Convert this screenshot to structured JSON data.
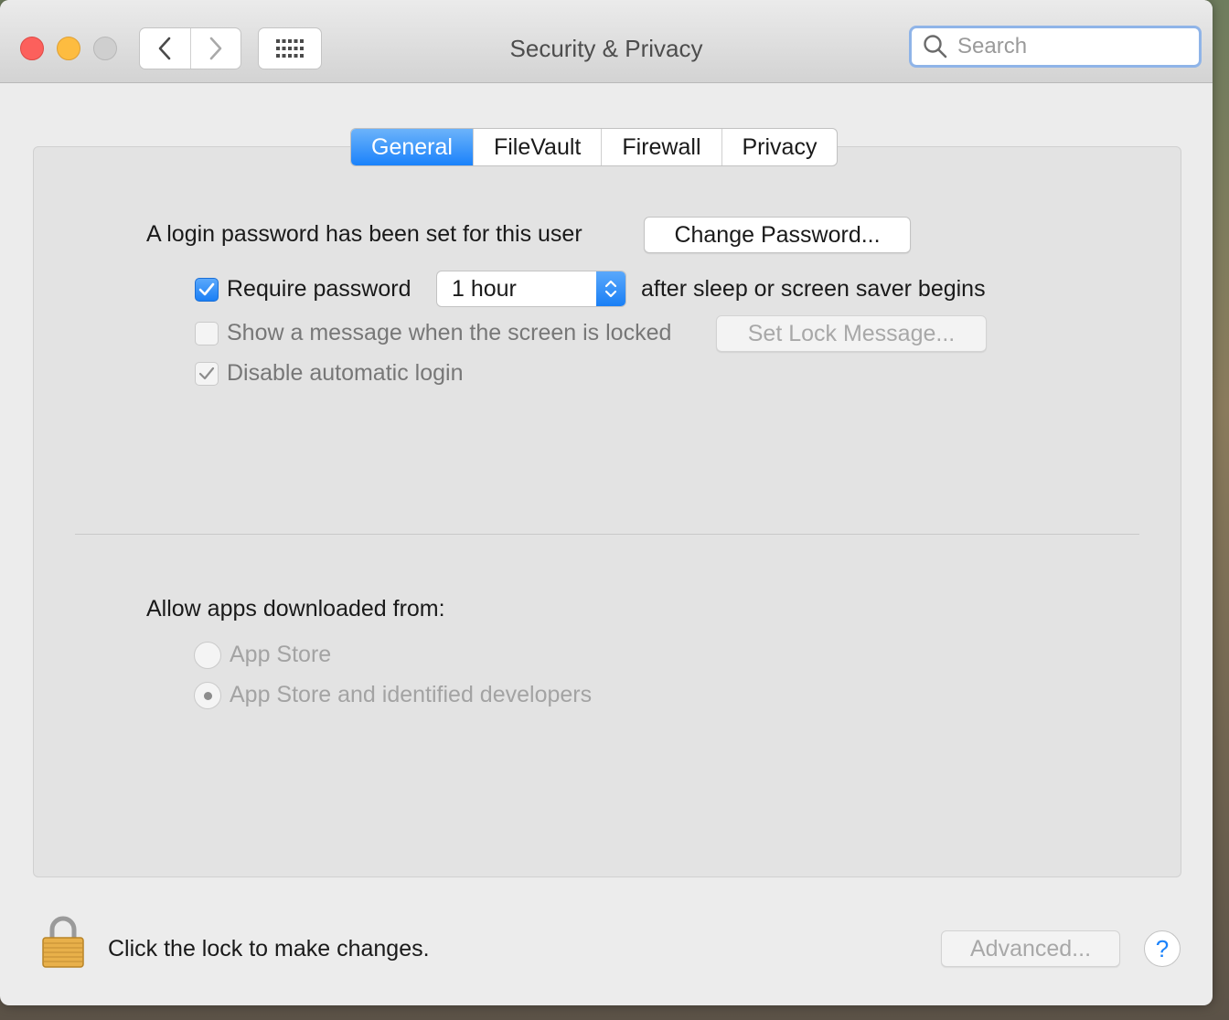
{
  "window": {
    "title": "Security & Privacy",
    "search_placeholder": "Search"
  },
  "tabs": [
    {
      "label": "General",
      "active": true
    },
    {
      "label": "FileVault",
      "active": false
    },
    {
      "label": "Firewall",
      "active": false
    },
    {
      "label": "Privacy",
      "active": false
    }
  ],
  "general": {
    "login_password_text": "A login password has been set for this user",
    "change_password_label": "Change Password...",
    "require_password": {
      "label": "Require password",
      "checked": true
    },
    "require_password_delay": "1 hour",
    "after_sleep_text": "after sleep or screen saver begins",
    "show_message": {
      "label": "Show a message when the screen is locked",
      "checked": false
    },
    "set_lock_message_label": "Set Lock Message...",
    "disable_auto_login": {
      "label": "Disable automatic login",
      "checked": true
    }
  },
  "allow_apps": {
    "heading": "Allow apps downloaded from:",
    "options": [
      {
        "label": "App Store",
        "selected": false
      },
      {
        "label": "App Store and identified developers",
        "selected": true
      }
    ]
  },
  "footer": {
    "lock_text": "Click the lock to make changes.",
    "advanced_label": "Advanced...",
    "help_label": "?"
  },
  "colors": {
    "accent": "#1a82fb",
    "close": "#fc605c",
    "minimize": "#fdbc40",
    "zoom_disabled": "#cfcfcf",
    "lock_gold": "#e8b04a"
  }
}
